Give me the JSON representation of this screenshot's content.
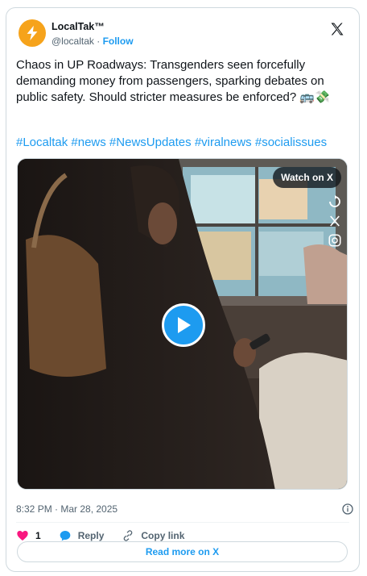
{
  "account": {
    "name": "LocalTak™",
    "handle": "@localtak",
    "separator": "·",
    "follow_label": "Follow"
  },
  "tweet": {
    "text": "Chaos in UP Roadways: Transgenders seen forcefully demanding money from passengers, sparking debates on public safety. Should stricter measures be enforced? 🚌💸",
    "hashtags": [
      "#Localtak",
      "#news",
      "#NewsUpdates",
      "#viralnews",
      "#socialissues"
    ]
  },
  "media": {
    "watch_label": "Watch on X"
  },
  "meta": {
    "timestamp": "8:32 PM · Mar 28, 2025"
  },
  "actions": {
    "like_count": "1",
    "reply_label": "Reply",
    "copy_link_label": "Copy link"
  },
  "footer": {
    "read_more_label": "Read more on X"
  },
  "colors": {
    "accent": "#1d9bf0",
    "like": "#f91880",
    "avatar_bg": "#f6a31b"
  }
}
